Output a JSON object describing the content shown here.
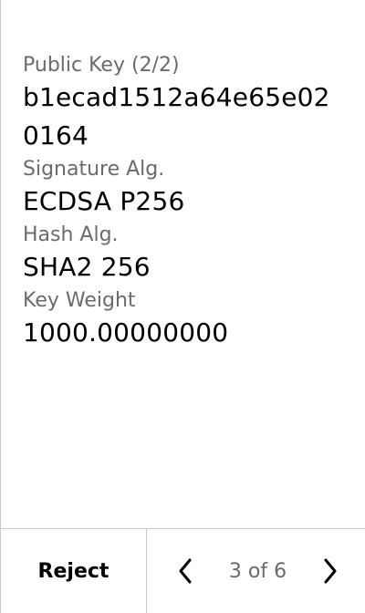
{
  "fields": [
    {
      "label": "Public Key (2/2)",
      "value": "b1ecad1512a64e65e020164"
    },
    {
      "label": "Signature Alg.",
      "value": "ECDSA P256"
    },
    {
      "label": "Hash Alg.",
      "value": "SHA2 256"
    },
    {
      "label": "Key Weight",
      "value": "1000.00000000"
    }
  ],
  "footer": {
    "reject_label": "Reject",
    "page_indicator": "3 of 6",
    "prev_icon": "chevron-left-icon",
    "next_icon": "chevron-right-icon"
  },
  "colors": {
    "label": "#6b6b6b",
    "value": "#000000",
    "divider": "#c8c8c8",
    "background": "#ffffff"
  }
}
